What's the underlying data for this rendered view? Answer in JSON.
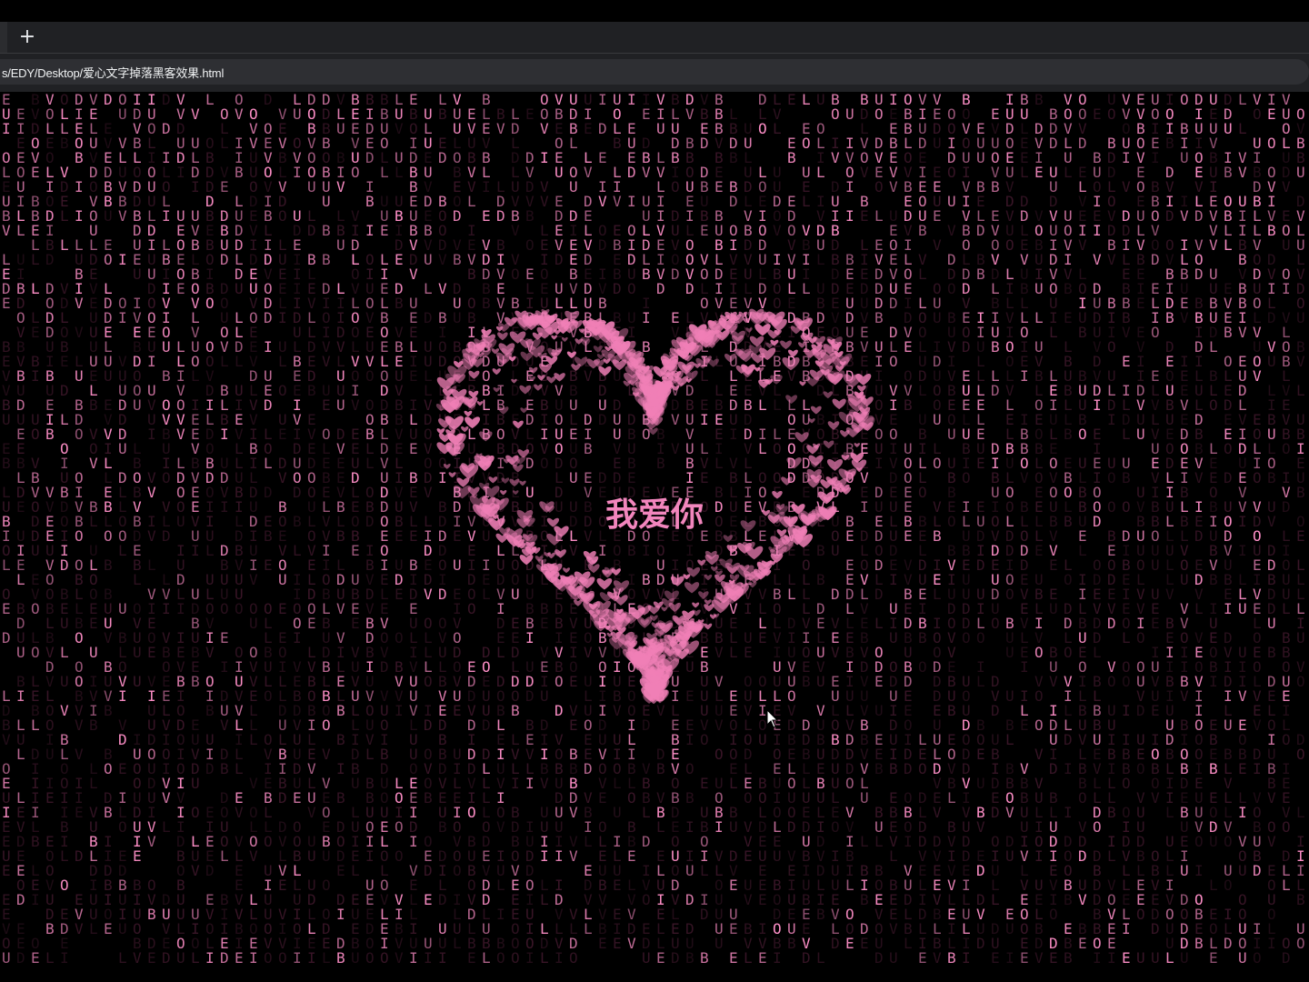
{
  "browser": {
    "new_tab_label": "+",
    "address_url": "s/EDY/Desktop/爱心文字掉落黑客效果.html"
  },
  "page": {
    "heart_text": "我爱你",
    "rain_alphabet": [
      "L",
      "O",
      "V",
      "E",
      "U",
      "I",
      "D",
      "B"
    ],
    "colors": {
      "background": "#000000",
      "rain_bright": "#ff8fc8",
      "rain_dim": "#3a1628",
      "heart": "#f07fb6",
      "heart_text": "#f286bd"
    }
  }
}
